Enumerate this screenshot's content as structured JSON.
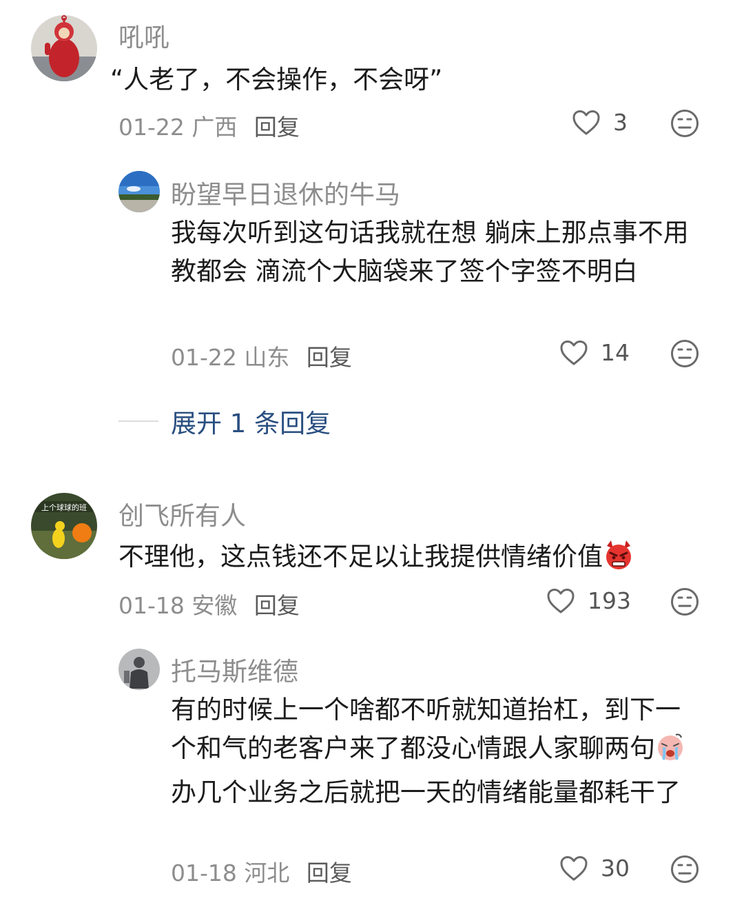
{
  "comments": [
    {
      "username": "吼吼",
      "text": "“人老了，不会操作，不会呀”",
      "date": "01-22",
      "location": "广西",
      "reply_label": "回复",
      "likes": "3",
      "replies": [
        {
          "username": "盼望早日退休的牛马",
          "text": "我每次听到这句话我就在想 躺床上那点事不用教都会 滴流个大脑袋来了签个字签不明白",
          "date": "01-22",
          "location": "山东",
          "reply_label": "回复",
          "likes": "14"
        }
      ],
      "expand_label": "展开 1 条回复"
    },
    {
      "username": "创飞所有人",
      "avatar_caption": "上个球球的班",
      "text": "不理他，这点钱还不足以让我提供情绪价值",
      "emoji": "angry-devil-emoji",
      "date": "01-18",
      "location": "安徽",
      "reply_label": "回复",
      "likes": "193",
      "replies": [
        {
          "username": "托马斯维德",
          "text_part1": "有的时候上一个啥都不听就知道抬杠，到下一个和气的老客户来了都没心情跟人家聊两句",
          "emoji": "crying-face-emoji",
          "text_part2": "办几个业务之后就把一天的情绪能量都耗干了",
          "date": "01-18",
          "location": "河北",
          "reply_label": "回复",
          "likes": "30"
        }
      ]
    }
  ],
  "icons": {
    "like": "heart-outline-icon",
    "dislike": "neutral-face-icon"
  },
  "colors": {
    "link": "#2a4f80",
    "meta": "#8d8d8d",
    "text": "#1c1c1c"
  }
}
